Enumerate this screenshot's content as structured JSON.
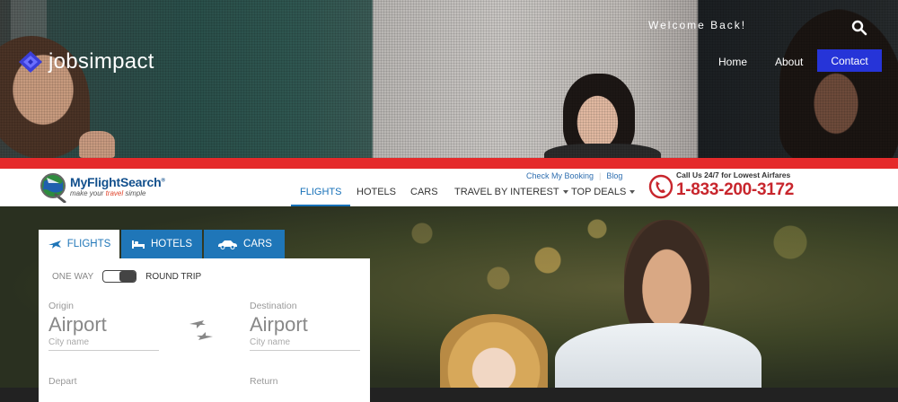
{
  "site": {
    "brand": "jobsimpact",
    "welcome": "Welcome Back!",
    "nav": {
      "home": "Home",
      "about": "About",
      "contact": "Contact"
    },
    "contact_color": "#2634d8"
  },
  "stripe_color": "#e52a2b",
  "mfs": {
    "logo_title": "MyFlightSearch",
    "logo_reg": "®",
    "logo_tag_pre": "make your ",
    "logo_tag_accent": "travel",
    "logo_tag_post": " simple",
    "util_links": [
      "Check My Booking",
      "Blog"
    ],
    "nav": [
      "FLIGHTS",
      "HOTELS",
      "CARS",
      "TRAVEL BY INTEREST",
      "TOP DEALS"
    ],
    "call_label": "Call Us 24/7 for Lowest Airfares",
    "call_number": "1-833-200-3172",
    "accent": "#1670b8",
    "phone_color": "#c8262d"
  },
  "widget": {
    "tabs": [
      "FLIGHTS",
      "HOTELS",
      "CARS"
    ],
    "active_tab": "FLIGHTS",
    "trip_one_way": "ONE WAY",
    "trip_round": "ROUND TRIP",
    "trip_selected": "ROUND TRIP",
    "origin": {
      "label": "Origin",
      "value": "Airport",
      "hint": "City name"
    },
    "destination": {
      "label": "Destination",
      "value": "Airport",
      "hint": "City name"
    },
    "depart": {
      "label": "Depart"
    },
    "return": {
      "label": "Return"
    }
  },
  "icons": [
    "search-icon",
    "brand-logo-icon",
    "globe-plane-icon",
    "phone-icon",
    "plane-icon",
    "bed-icon",
    "car-icon",
    "swap-planes-icon"
  ]
}
